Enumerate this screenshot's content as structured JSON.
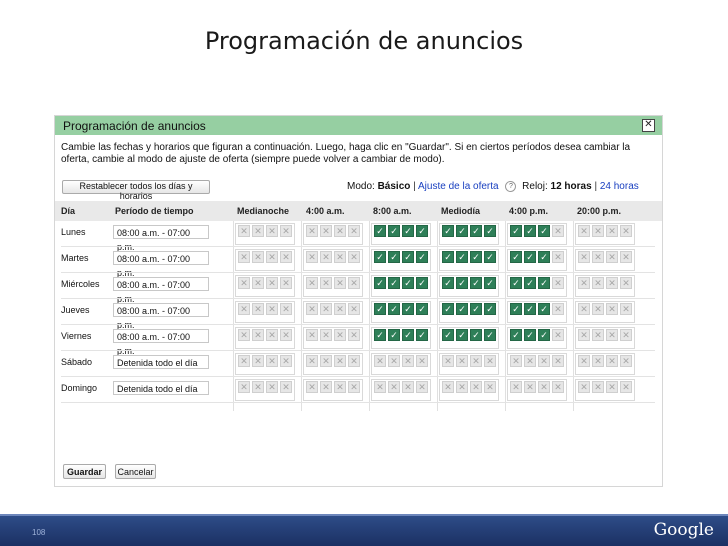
{
  "slide": {
    "title": "Programación de anuncios",
    "page_number": "108",
    "logo": "Google"
  },
  "dialog": {
    "title": "Programación de anuncios",
    "close_icon": "close-icon",
    "instructions": "Cambie las fechas y horarios que figuran a continuación. Luego, haga clic en \"Guardar\". Si en ciertos períodos desea cambiar la oferta, cambie al modo de ajuste de oferta (siempre puede volver a cambiar de modo).",
    "reset_button": "Restablecer todos los días y horarios",
    "mode": {
      "label": "Modo:",
      "value": "Básico",
      "alt_link": "Ajuste de la oferta"
    },
    "clock": {
      "help_icon": "help-icon",
      "label": "Reloj:",
      "value": "12 horas",
      "alt_link": "24 horas",
      "separator": "|"
    },
    "columns": [
      "Día",
      "Período de tiempo",
      "Medianoche",
      "4:00 a.m.",
      "8:00 a.m.",
      "Mediodía",
      "4:00 p.m.",
      "20:00 p.m."
    ],
    "rows": [
      {
        "day": "Lunes",
        "period": "08:00 a.m. - 07:00 p.m.",
        "blocks": [
          [
            0,
            0,
            0,
            0
          ],
          [
            0,
            0,
            0,
            0
          ],
          [
            1,
            1,
            1,
            1
          ],
          [
            1,
            1,
            1,
            1
          ],
          [
            1,
            1,
            1,
            0
          ],
          [
            0,
            0,
            0,
            0
          ]
        ]
      },
      {
        "day": "Martes",
        "period": "08:00 a.m. - 07:00 p.m.",
        "blocks": [
          [
            0,
            0,
            0,
            0
          ],
          [
            0,
            0,
            0,
            0
          ],
          [
            1,
            1,
            1,
            1
          ],
          [
            1,
            1,
            1,
            1
          ],
          [
            1,
            1,
            1,
            0
          ],
          [
            0,
            0,
            0,
            0
          ]
        ]
      },
      {
        "day": "Miércoles",
        "period": "08:00 a.m. - 07:00 p.m.",
        "blocks": [
          [
            0,
            0,
            0,
            0
          ],
          [
            0,
            0,
            0,
            0
          ],
          [
            1,
            1,
            1,
            1
          ],
          [
            1,
            1,
            1,
            1
          ],
          [
            1,
            1,
            1,
            0
          ],
          [
            0,
            0,
            0,
            0
          ]
        ]
      },
      {
        "day": "Jueves",
        "period": "08:00 a.m. - 07:00 p.m.",
        "blocks": [
          [
            0,
            0,
            0,
            0
          ],
          [
            0,
            0,
            0,
            0
          ],
          [
            1,
            1,
            1,
            1
          ],
          [
            1,
            1,
            1,
            1
          ],
          [
            1,
            1,
            1,
            0
          ],
          [
            0,
            0,
            0,
            0
          ]
        ]
      },
      {
        "day": "Viernes",
        "period": "08:00 a.m. - 07:00 p.m.",
        "blocks": [
          [
            0,
            0,
            0,
            0
          ],
          [
            0,
            0,
            0,
            0
          ],
          [
            1,
            1,
            1,
            1
          ],
          [
            1,
            1,
            1,
            1
          ],
          [
            1,
            1,
            1,
            0
          ],
          [
            0,
            0,
            0,
            0
          ]
        ]
      },
      {
        "day": "Sábado",
        "period": "Detenida todo el día",
        "blocks": [
          [
            0,
            0,
            0,
            0
          ],
          [
            0,
            0,
            0,
            0
          ],
          [
            0,
            0,
            0,
            0
          ],
          [
            0,
            0,
            0,
            0
          ],
          [
            0,
            0,
            0,
            0
          ],
          [
            0,
            0,
            0,
            0
          ]
        ]
      },
      {
        "day": "Domingo",
        "period": "Detenida todo el día",
        "blocks": [
          [
            0,
            0,
            0,
            0
          ],
          [
            0,
            0,
            0,
            0
          ],
          [
            0,
            0,
            0,
            0
          ],
          [
            0,
            0,
            0,
            0
          ],
          [
            0,
            0,
            0,
            0
          ],
          [
            0,
            0,
            0,
            0
          ]
        ]
      }
    ],
    "save_button": "Guardar",
    "cancel_button": "Cancelar"
  },
  "colors": {
    "header_bar": "#96cfa2",
    "active_cell": "#2e7f58",
    "inactive_cell": "#e6e6e6",
    "link": "#1a40c0",
    "footer": "#1b3063"
  },
  "glyphs": {
    "active": "✓",
    "inactive": "✕"
  }
}
